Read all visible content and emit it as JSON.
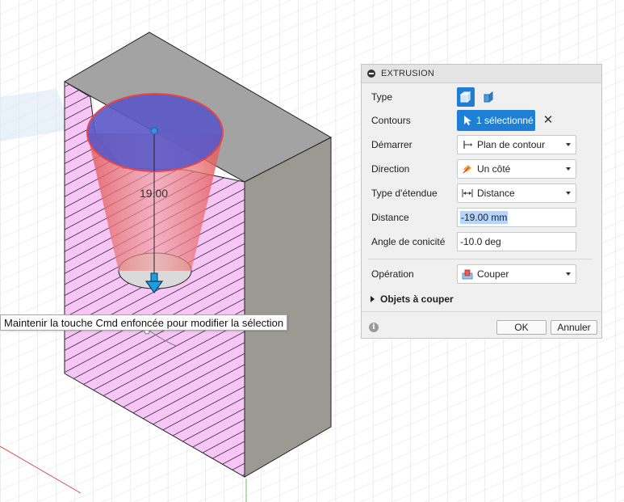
{
  "viewport": {
    "dimension_label": "19.00"
  },
  "dialog": {
    "title": "EXTRUSION",
    "fields": {
      "type_label": "Type",
      "contours_label": "Contours",
      "contours_value": "1 sélectionné",
      "start_label": "Démarrer",
      "start_value": "Plan de contour",
      "direction_label": "Direction",
      "direction_value": "Un côté",
      "extent_label": "Type d'étendue",
      "extent_value": "Distance",
      "distance_label": "Distance",
      "distance_value": "-19.00 mm",
      "taper_label": "Angle de conicité",
      "taper_value": "-10.0 deg",
      "operation_label": "Opération",
      "operation_value": "Couper",
      "objects_label": "Objets à couper"
    },
    "buttons": {
      "ok": "OK",
      "cancel": "Annuler"
    }
  },
  "tooltip": {
    "text": "Maintenir la touche Cmd enfoncée pour modifier la sélection"
  },
  "colors": {
    "accent": "#1d7fd6",
    "hatch_face": "#f5c6f5",
    "top_face": "#a3a3a3",
    "side_face": "#9b9b94",
    "tool_body": "#e36a6a",
    "tool_top": "#5a56c8"
  }
}
